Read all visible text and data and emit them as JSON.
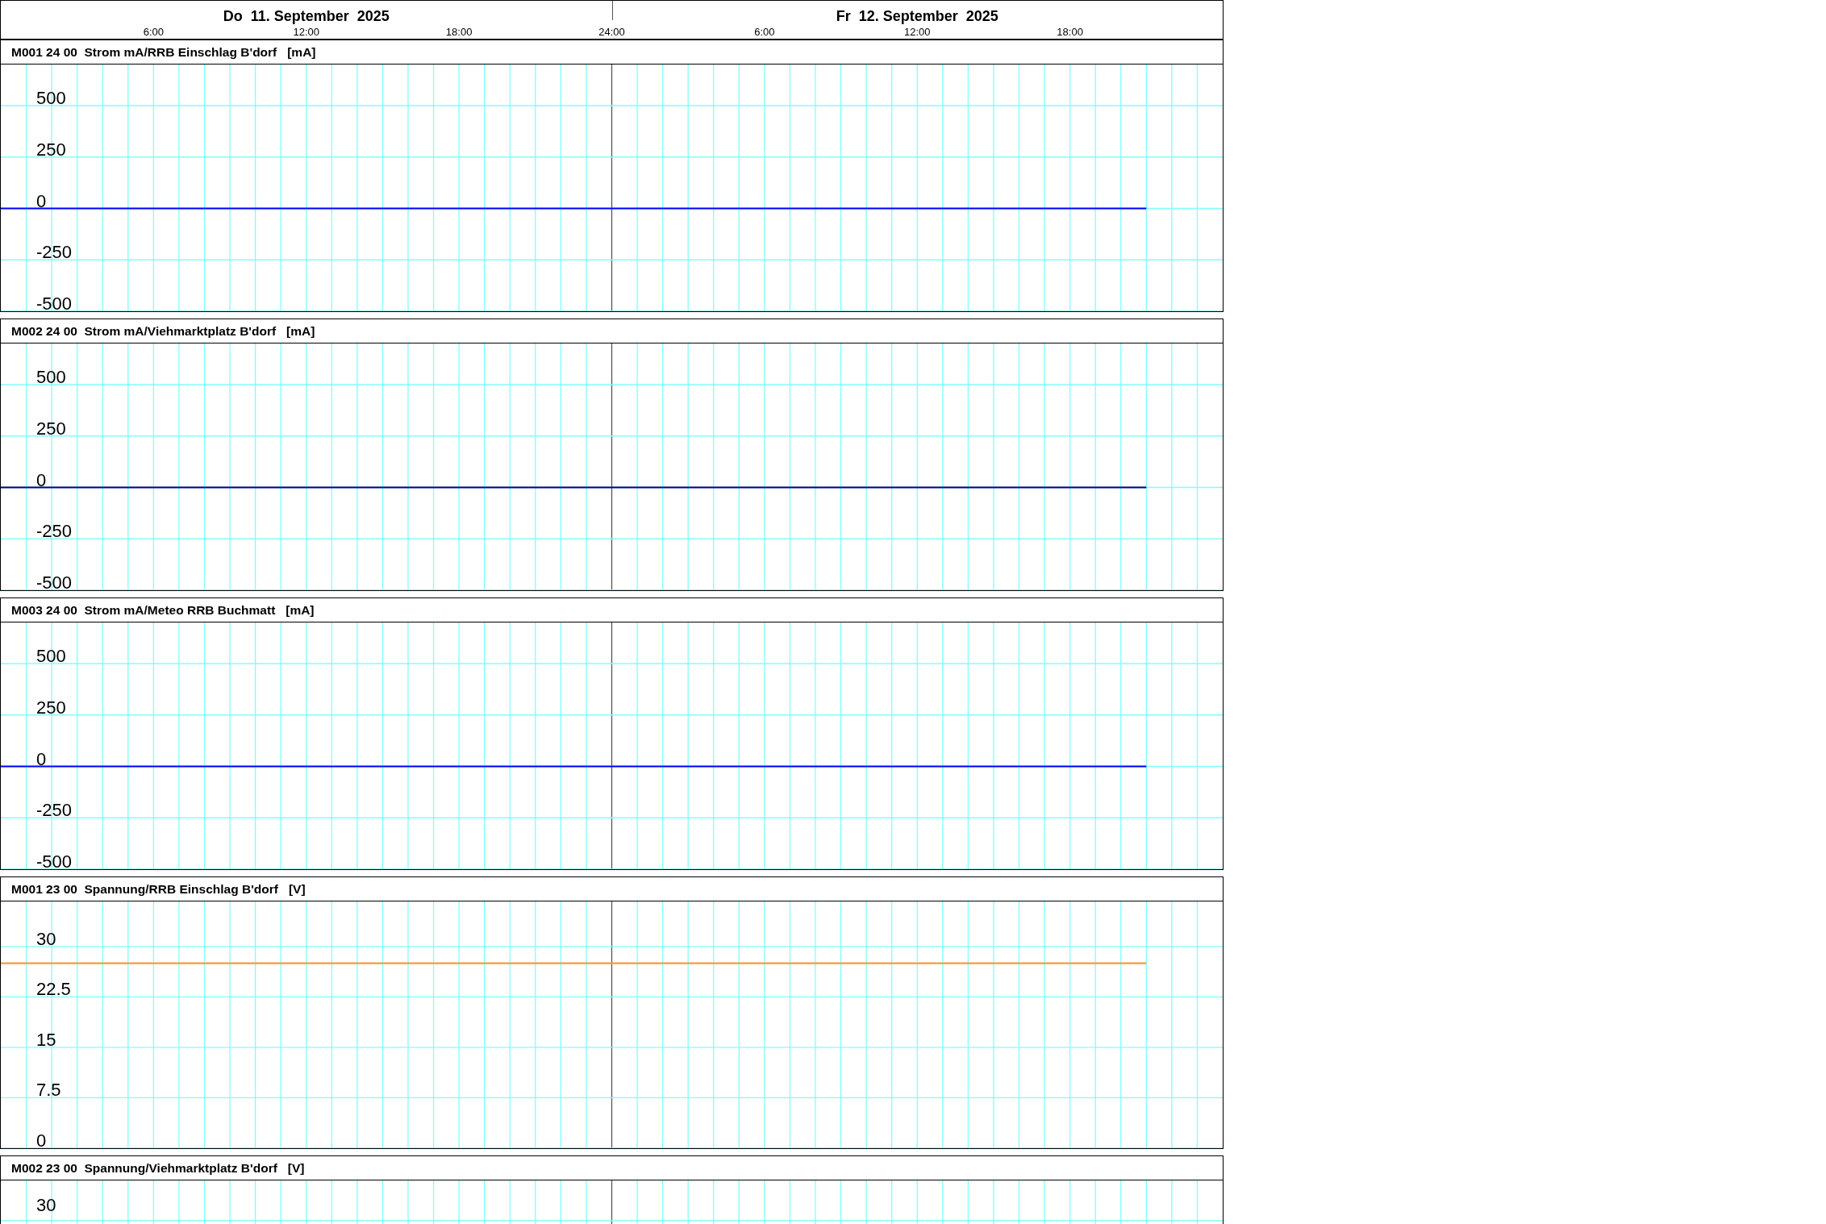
{
  "time_axis": {
    "days": [
      {
        "label": "Do  11. September  2025",
        "hour_labels": [
          "6:00",
          "12:00",
          "18:00",
          "24:00"
        ]
      },
      {
        "label": "Fr  12. September  2025",
        "hour_labels": [
          "6:00",
          "12:00",
          "18:00"
        ]
      }
    ]
  },
  "panels": [
    {
      "title": "M001 24 00  Strom mA/RRB Einschlag B'dorf   [mA]",
      "chart_data": {
        "type": "line",
        "grid": true,
        "categories": [
          null,
          null,
          null,
          null,
          null,
          null,
          null,
          null,
          null,
          null,
          null,
          null,
          null,
          null,
          null,
          null,
          null,
          null,
          null,
          null,
          null,
          null,
          null,
          null,
          null,
          null,
          null,
          null,
          null,
          null,
          null,
          null,
          null,
          null,
          null,
          null,
          null,
          null,
          null,
          null,
          null,
          null,
          null,
          null,
          null,
          null,
          null,
          null
        ],
        "ylim": [
          -500,
          700
        ],
        "yticks": [
          -500,
          -250,
          0,
          250,
          500
        ],
        "series": [
          {
            "color": "#0000ff",
            "values": [
              0,
              0,
              0,
              0,
              0,
              0,
              0,
              0,
              0,
              0,
              0,
              0,
              0,
              0,
              0,
              0,
              0,
              0,
              0,
              0,
              0,
              0,
              0,
              0,
              0,
              0,
              0,
              0,
              0,
              0,
              0,
              0,
              0,
              0,
              0,
              0,
              0,
              0,
              0,
              0,
              0,
              0,
              0,
              0,
              0,
              0,
              null,
              null
            ]
          }
        ]
      }
    },
    {
      "title": "M002 24 00  Strom mA/Viehmarktplatz B'dorf   [mA]",
      "chart_data": {
        "type": "line",
        "grid": true,
        "categories": [
          null,
          null,
          null,
          null,
          null,
          null,
          null,
          null,
          null,
          null,
          null,
          null,
          null,
          null,
          null,
          null,
          null,
          null,
          null,
          null,
          null,
          null,
          null,
          null,
          null,
          null,
          null,
          null,
          null,
          null,
          null,
          null,
          null,
          null,
          null,
          null,
          null,
          null,
          null,
          null,
          null,
          null,
          null,
          null,
          null,
          null,
          null,
          null
        ],
        "ylim": [
          -500,
          700
        ],
        "yticks": [
          -500,
          -250,
          0,
          250,
          500
        ],
        "series": [
          {
            "color": "#000080",
            "values": [
              0,
              0,
              0,
              0,
              0,
              0,
              0,
              0,
              0,
              0,
              0,
              0,
              0,
              0,
              0,
              0,
              0,
              0,
              0,
              0,
              0,
              0,
              0,
              0,
              0,
              0,
              0,
              0,
              0,
              0,
              0,
              0,
              0,
              0,
              0,
              0,
              0,
              0,
              0,
              0,
              0,
              0,
              0,
              0,
              0,
              0,
              null,
              null
            ]
          }
        ]
      }
    },
    {
      "title": "M003 24 00  Strom mA/Meteo RRB Buchmatt   [mA]",
      "chart_data": {
        "type": "line",
        "grid": true,
        "categories": [
          null,
          null,
          null,
          null,
          null,
          null,
          null,
          null,
          null,
          null,
          null,
          null,
          null,
          null,
          null,
          null,
          null,
          null,
          null,
          null,
          null,
          null,
          null,
          null,
          null,
          null,
          null,
          null,
          null,
          null,
          null,
          null,
          null,
          null,
          null,
          null,
          null,
          null,
          null,
          null,
          null,
          null,
          null,
          null,
          null,
          null,
          null,
          null
        ],
        "ylim": [
          -500,
          700
        ],
        "yticks": [
          -500,
          -250,
          0,
          250,
          500
        ],
        "series": [
          {
            "color": "#0000ff",
            "values": [
              0,
              0,
              0,
              0,
              0,
              0,
              0,
              0,
              0,
              0,
              0,
              0,
              0,
              0,
              0,
              0,
              0,
              0,
              0,
              0,
              0,
              0,
              0,
              0,
              0,
              0,
              0,
              0,
              0,
              0,
              0,
              0,
              0,
              0,
              0,
              0,
              0,
              0,
              0,
              0,
              0,
              0,
              0,
              0,
              0,
              0,
              null,
              null
            ]
          }
        ]
      }
    },
    {
      "title": "M001 23 00  Spannung/RRB Einschlag B'dorf   [V]",
      "chart_data": {
        "type": "line",
        "grid": true,
        "categories": [
          null,
          null,
          null,
          null,
          null,
          null,
          null,
          null,
          null,
          null,
          null,
          null,
          null,
          null,
          null,
          null,
          null,
          null,
          null,
          null,
          null,
          null,
          null,
          null,
          null,
          null,
          null,
          null,
          null,
          null,
          null,
          null,
          null,
          null,
          null,
          null,
          null,
          null,
          null,
          null,
          null,
          null,
          null,
          null,
          null,
          null,
          null,
          null
        ],
        "ylim": [
          0,
          36.7
        ],
        "yticks": [
          0,
          7.5,
          15,
          22.5,
          30
        ],
        "series": [
          {
            "color": "#f0a030",
            "values": [
              27.5,
              27.5,
              27.5,
              27.5,
              27.5,
              27.5,
              27.5,
              27.5,
              27.5,
              27.5,
              27.5,
              27.5,
              27.5,
              27.5,
              27.5,
              27.5,
              27.5,
              27.5,
              27.5,
              27.5,
              27.5,
              27.5,
              27.5,
              27.5,
              27.5,
              27.5,
              27.5,
              27.5,
              27.5,
              27.5,
              27.5,
              27.5,
              27.5,
              27.5,
              27.5,
              27.5,
              27.5,
              27.5,
              27.5,
              27.5,
              27.5,
              27.5,
              27.5,
              27.5,
              27.5,
              27.5,
              null,
              null
            ]
          }
        ]
      }
    },
    {
      "title": "M002 23 00  Spannung/Viehmarktplatz B'dorf   [V]",
      "chart_data": {
        "type": "other",
        "annotations": [
          "30"
        ]
      }
    }
  ]
}
